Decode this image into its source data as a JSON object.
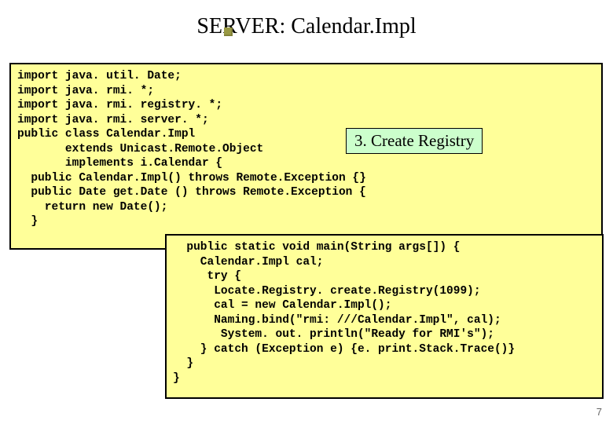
{
  "title": "SERVER: Calendar.Impl",
  "callout": "3. Create Registry",
  "corner": "7",
  "code1": "import java. util. Date;\nimport java. rmi. *;\nimport java. rmi. registry. *;\nimport java. rmi. server. *;\npublic class Calendar.Impl\n       extends Unicast.Remote.Object\n       implements i.Calendar {\n  public Calendar.Impl() throws Remote.Exception {}\n  public Date get.Date () throws Remote.Exception {\n    return new Date();\n  }",
  "code2": "  public static void main(String args[]) {\n    Calendar.Impl cal;\n     try {\n      Locate.Registry. create.Registry(1099);\n      cal = new Calendar.Impl();\n      Naming.bind(\"rmi: ///Calendar.Impl\", cal);\n       System. out. println(\"Ready for RMI's\");\n    } catch (Exception e) {e. print.Stack.Trace()}\n  }\n}"
}
